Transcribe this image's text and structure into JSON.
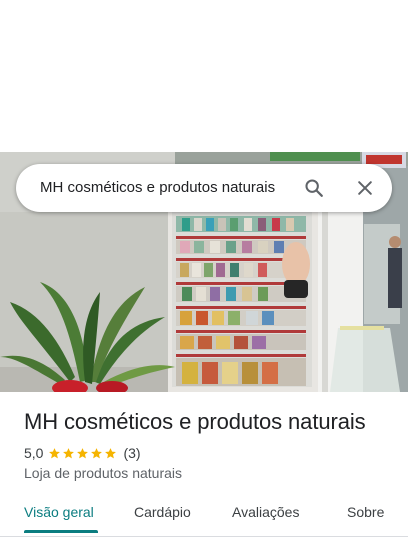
{
  "search": {
    "query": "MH cosméticos e produtos naturais"
  },
  "icons": {
    "search": "search-icon",
    "close": "close-icon",
    "star": "star-icon"
  },
  "place": {
    "title": "MH cosméticos e produtos naturais",
    "rating": "5,0",
    "stars": 5,
    "review_count": "(3)",
    "category": "Loja de produtos naturais"
  },
  "tabs": [
    {
      "label": "Visão geral",
      "active": true
    },
    {
      "label": "Cardápio",
      "active": false
    },
    {
      "label": "Avaliações",
      "active": false
    },
    {
      "label": "Sobre",
      "active": false
    }
  ],
  "colors": {
    "accent": "#0b7d80",
    "star": "#f5b400",
    "text_primary": "#202124",
    "text_secondary": "#5f6368"
  }
}
